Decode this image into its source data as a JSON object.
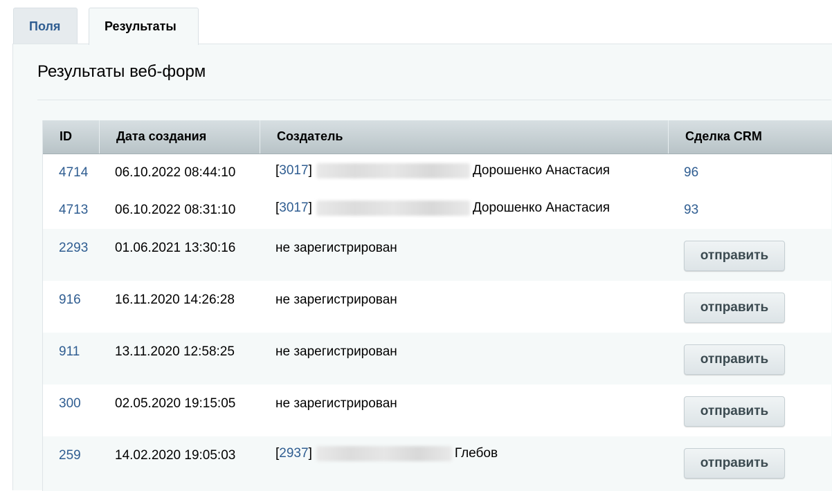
{
  "tabs": [
    {
      "label": "Поля",
      "active": false
    },
    {
      "label": "Результаты",
      "active": true
    }
  ],
  "page_title": "Результаты веб-форм",
  "table": {
    "headers": {
      "id": "ID",
      "date": "Дата создания",
      "creator": "Создатель",
      "crm": "Сделка CRM"
    },
    "rows": [
      {
        "id": "4714",
        "date": "06.10.2022 08:44:10",
        "user_id": "3017",
        "name": "Дорошенко Анастасия",
        "creator": "",
        "crm": "96",
        "button": ""
      },
      {
        "id": "4713",
        "date": "06.10.2022 08:31:10",
        "user_id": "3017",
        "name": "Дорошенко Анастасия",
        "creator": "",
        "crm": "93",
        "button": ""
      },
      {
        "id": "2293",
        "date": "01.06.2021 13:30:16",
        "user_id": "",
        "name": "",
        "creator": "не зарегистрирован",
        "crm": "",
        "button": "отправить"
      },
      {
        "id": "916",
        "date": "16.11.2020 14:26:28",
        "user_id": "",
        "name": "",
        "creator": "не зарегистрирован",
        "crm": "",
        "button": "отправить"
      },
      {
        "id": "911",
        "date": "13.11.2020 12:58:25",
        "user_id": "",
        "name": "",
        "creator": "не зарегистрирован",
        "crm": "",
        "button": "отправить"
      },
      {
        "id": "300",
        "date": "02.05.2020 19:15:05",
        "user_id": "",
        "name": "",
        "creator": "не зарегистрирован",
        "crm": "",
        "button": "отправить"
      },
      {
        "id": "259",
        "date": "14.02.2020 19:05:03",
        "user_id": "2937",
        "name": "Глебов",
        "creator": "",
        "crm": "",
        "button": "отправить"
      }
    ]
  },
  "colors": {
    "link": "#2f5d91",
    "panel_bg": "#f5f9f9",
    "header_bg": "#c5cfd3"
  }
}
